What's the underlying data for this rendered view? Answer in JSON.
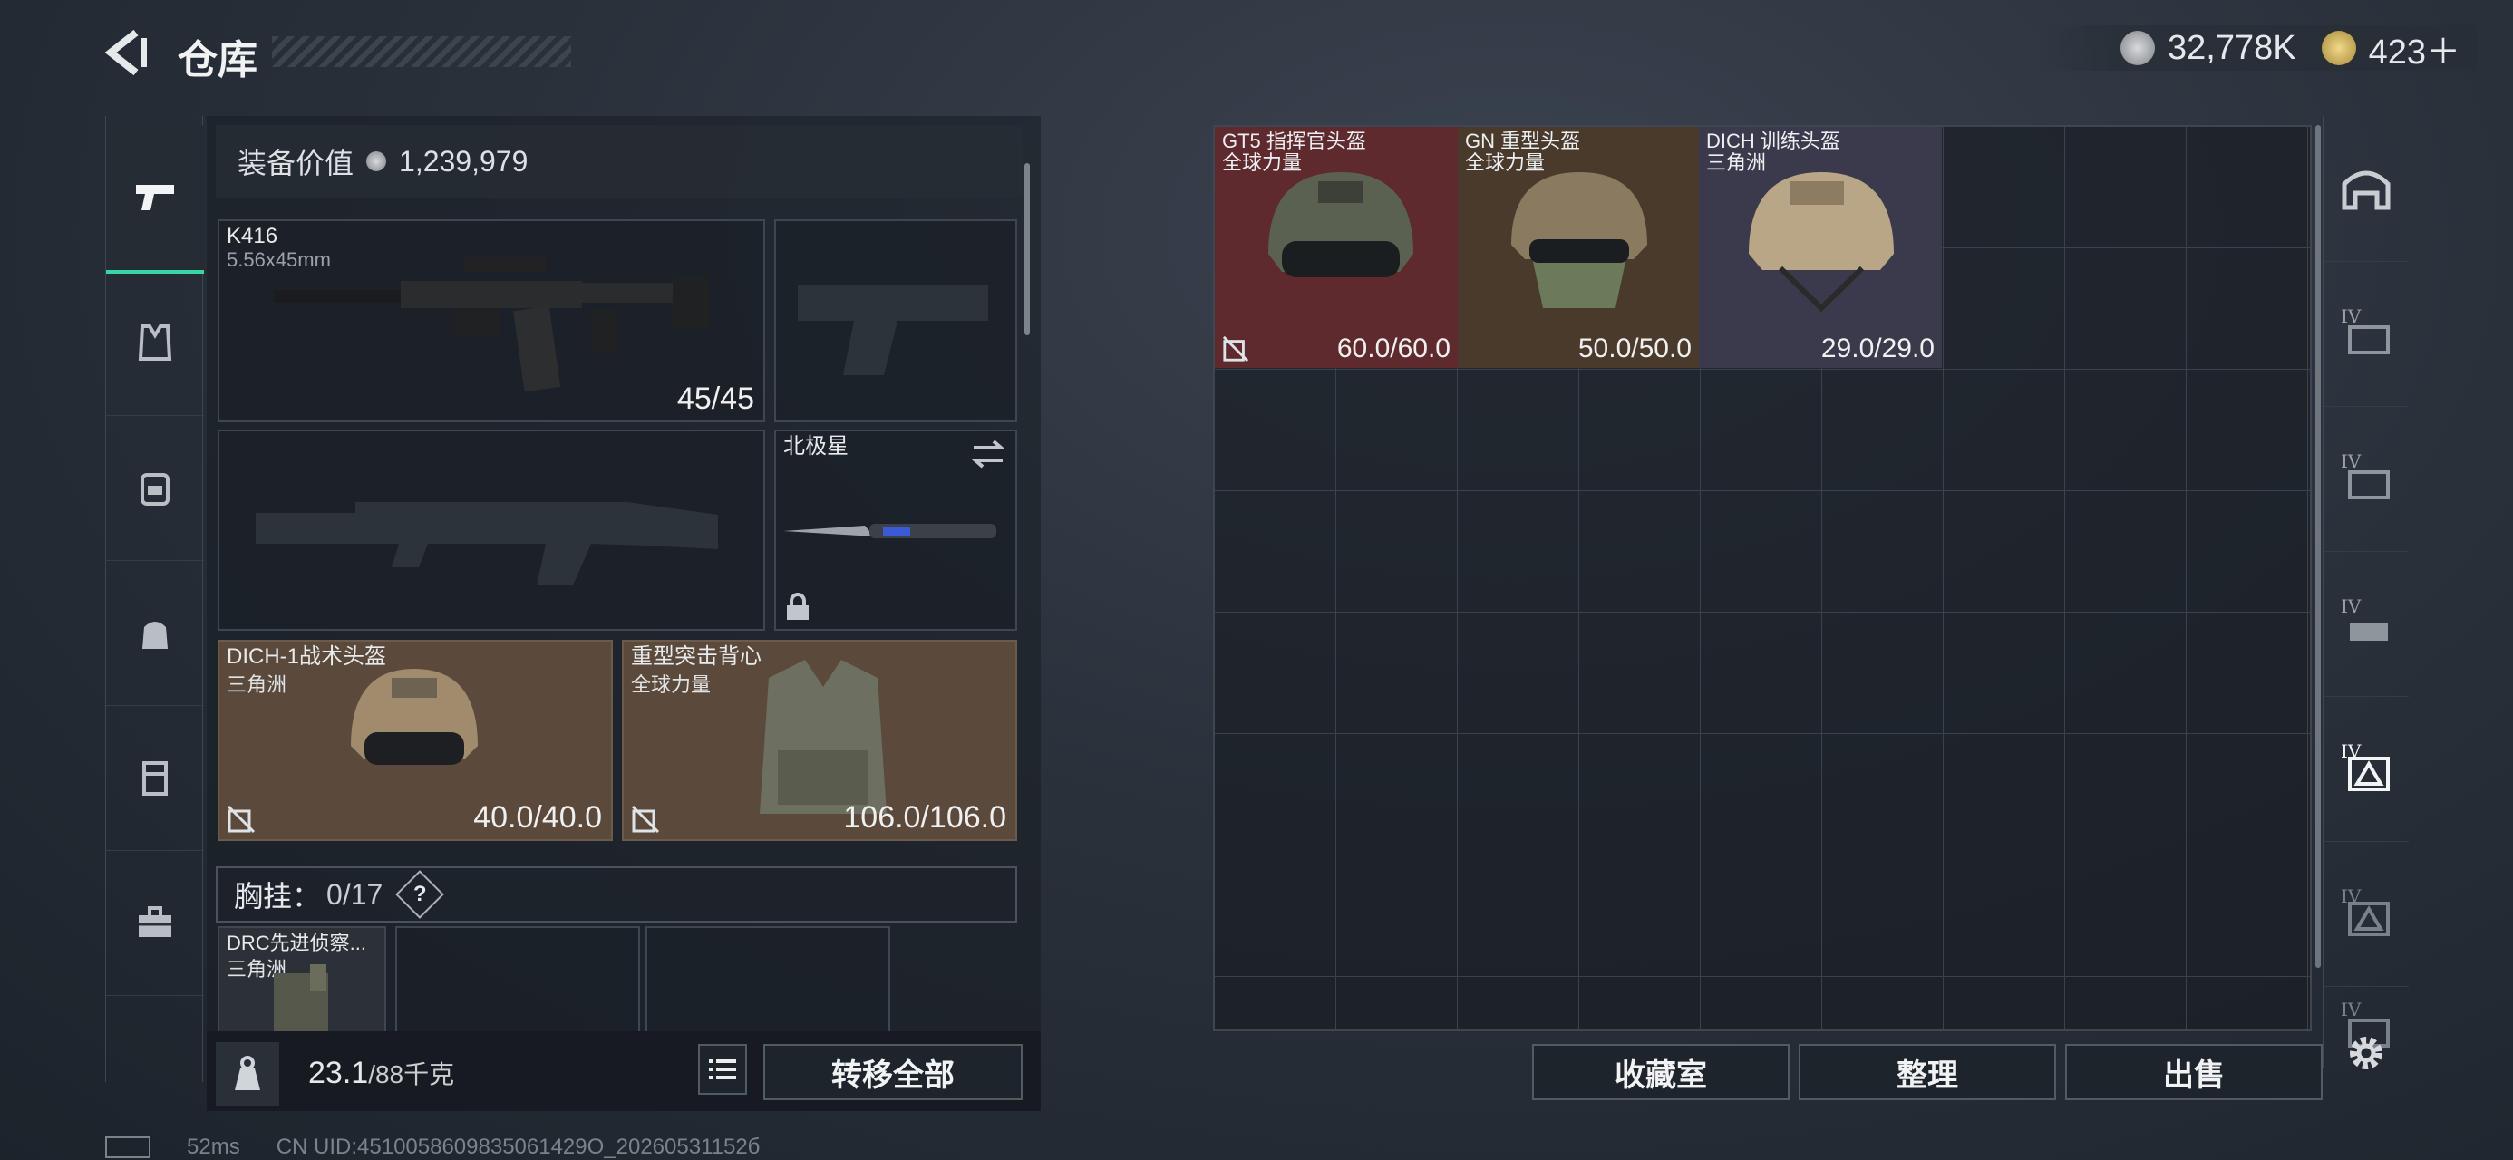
{
  "header": {
    "title": "仓库",
    "silver": "32,778K",
    "gold": "423＋"
  },
  "equipment": {
    "value_label": "装备价值",
    "value": "1,239,979",
    "primary_weapon": {
      "name": "K416",
      "ammo": "5.56x45mm",
      "durability": "45/45"
    },
    "melee": {
      "name": "北极星"
    },
    "helmet": {
      "name": "DICH-1战术头盔",
      "faction": "三角洲",
      "durability": "40.0/40.0"
    },
    "armor": {
      "name": "重型突击背心",
      "faction": "全球力量",
      "durability": "106.0/106.0"
    },
    "chest_rig": {
      "label": "胸挂：",
      "capacity": "0/17",
      "help": "?"
    },
    "chest_item": {
      "name": "DRC先进侦察...",
      "faction": "三角洲"
    }
  },
  "footer": {
    "weight": "23.1",
    "weight_max": "/88千克",
    "transfer_all": "转移全部",
    "collection": "收藏室",
    "organize": "整理",
    "sell": "出售"
  },
  "storage": {
    "items": [
      {
        "name": "GT5 指挥官头盔",
        "faction": "全球力量",
        "durability": "60.0/60.0"
      },
      {
        "name": "GN 重型头盔",
        "faction": "全球力量",
        "durability": "50.0/50.0"
      },
      {
        "name": "DICH 训练头盔",
        "faction": "三角洲",
        "durability": "29.0/29.0"
      }
    ],
    "tier_labels": [
      "IV",
      "IV",
      "IV",
      "IV",
      "IV",
      "IV"
    ]
  },
  "status": {
    "ping": "52ms",
    "uid": "CN UID:4510058609835061429O_20260531152б"
  },
  "colors": {
    "accent": "#38d6a4",
    "brown_slot": "#5b4a3c",
    "red_item": "#5e2a2e",
    "green_item": "#4a3a2c",
    "blue_item": "#3a3a4c"
  }
}
